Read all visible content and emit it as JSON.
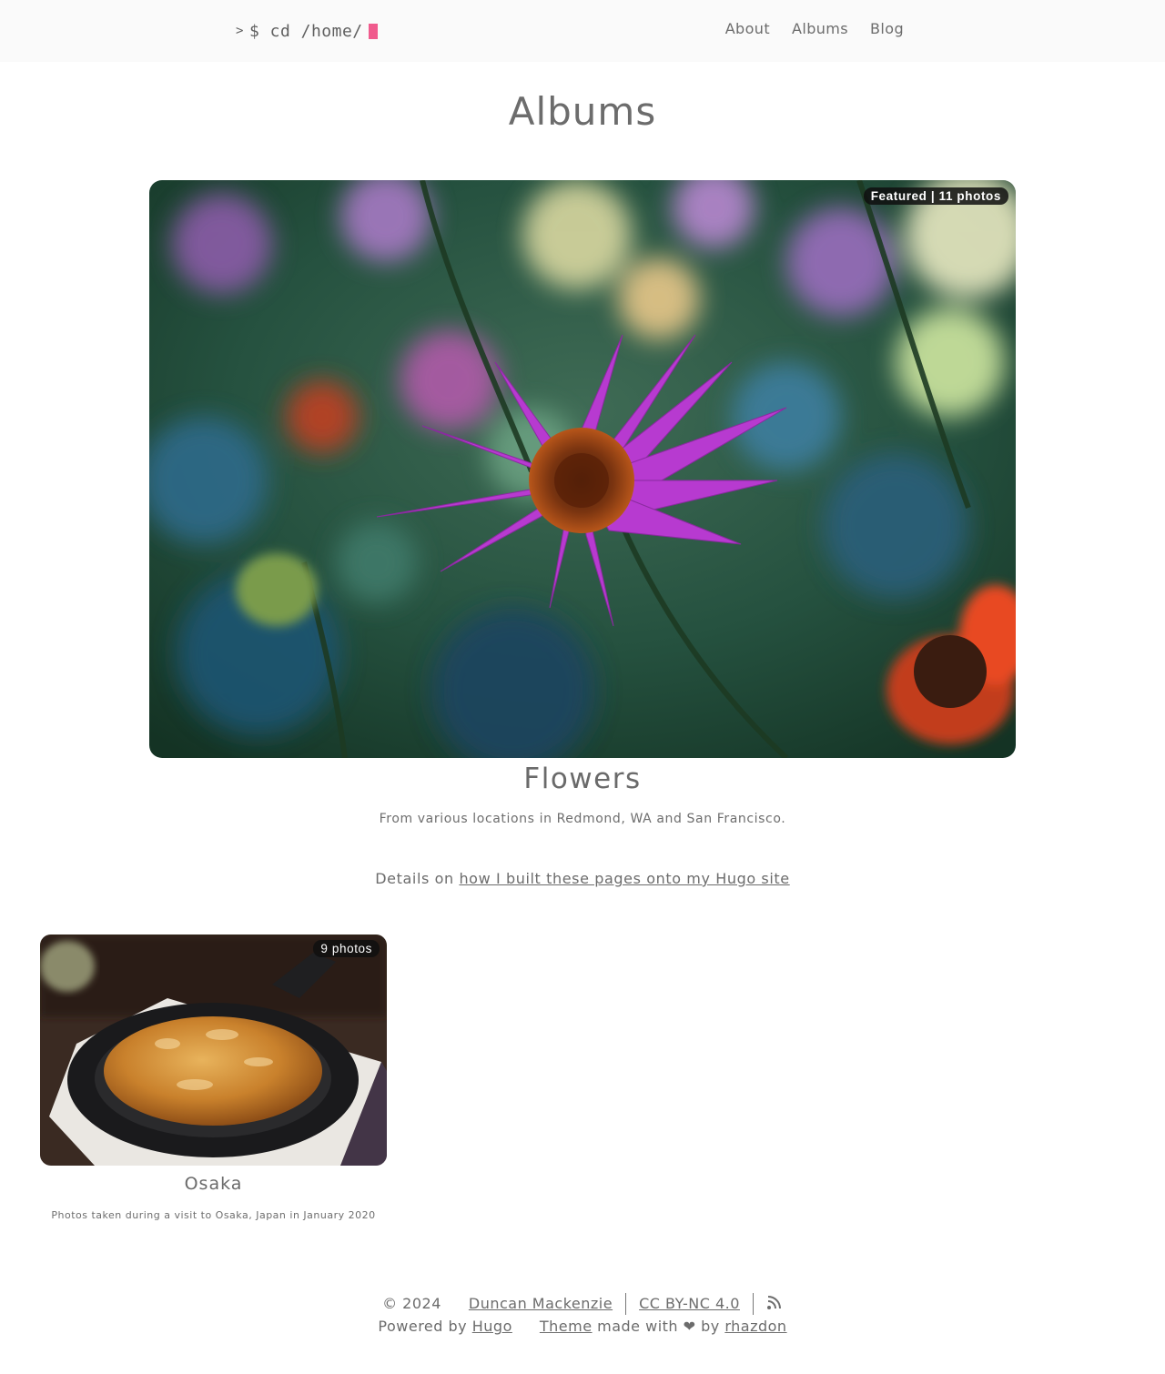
{
  "header": {
    "brand_prompt": ">",
    "brand_text": "$ cd /home/",
    "cursor_color": "#f05b8d",
    "nav": [
      {
        "label": "About"
      },
      {
        "label": "Albums"
      },
      {
        "label": "Blog"
      }
    ]
  },
  "page": {
    "title": "Albums"
  },
  "featured": {
    "badge": "Featured | 11 photos",
    "title": "Flowers",
    "description": "From various locations in Redmond, WA and San Francisco.",
    "image_icon": "flower-photo"
  },
  "details": {
    "prefix": "Details on ",
    "link": "how I built these pages onto my Hugo site"
  },
  "albums": [
    {
      "badge": "9 photos",
      "title": "Osaka",
      "description": "Photos taken during a visit to Osaka, Japan in January 2020",
      "image_icon": "gyoza-skillet-photo"
    }
  ],
  "footer": {
    "copyright": "© 2024",
    "author": "Duncan Mackenzie",
    "license": "CC BY-NC 4.0",
    "rss_icon": "rss-icon",
    "powered_by": "Powered by ",
    "hugo": "Hugo",
    "theme": "Theme",
    "made_with": " made with ",
    "heart": "❤",
    "by": " by ",
    "theme_author": "rhazdon"
  }
}
